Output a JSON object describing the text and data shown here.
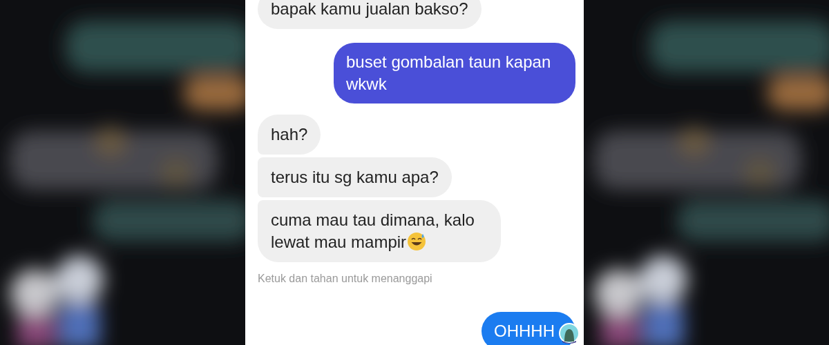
{
  "messages": [
    {
      "kind": "received",
      "text": "bapak kamu jualan bakso?",
      "emoji": false
    },
    {
      "kind": "sent",
      "text": "buset gombalan taun kapan wkwk",
      "color": "#4a4fd8",
      "seen_avatar": false
    },
    {
      "kind": "received",
      "text": "hah?",
      "emoji": false
    },
    {
      "kind": "received",
      "text": "terus itu sg kamu apa?",
      "emoji": false
    },
    {
      "kind": "received",
      "text": "cuma mau tau dimana, kalo lewat mau mampir",
      "emoji": true
    },
    {
      "kind": "hint",
      "text": "Ketuk dan tahan untuk menanggapi"
    },
    {
      "kind": "sent",
      "text": "OHHHH",
      "color": "#1b7cf0",
      "seen_avatar": true
    }
  ]
}
